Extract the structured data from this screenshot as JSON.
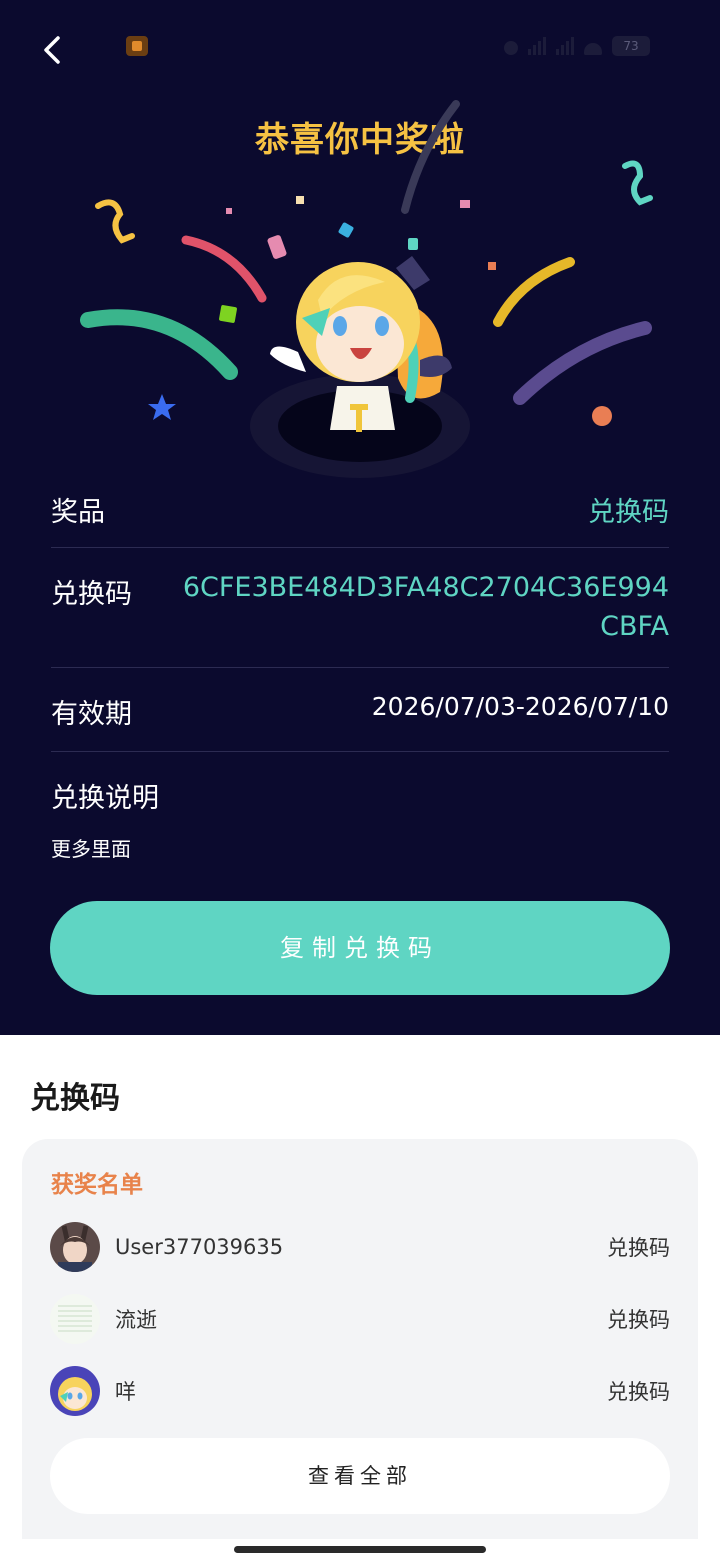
{
  "status_bar": {
    "battery": "73"
  },
  "header": {
    "title": "恭喜你中奖啦"
  },
  "details": {
    "prize_label": "奖品",
    "prize_value": "兑换码",
    "code_label": "兑换码",
    "code_value": "6CFE3BE484D3FA48C2704C36E994CBFA",
    "valid_label": "有效期",
    "valid_value": "2026/07/03-2026/07/10",
    "desc_label": "兑换说明",
    "desc_text": "更多里面"
  },
  "copy_button": {
    "label": "复制兑换码"
  },
  "bottom": {
    "section_title": "兑换码",
    "card_title": "获奖名单",
    "winners": [
      {
        "name": "User377039635",
        "prize": "兑换码"
      },
      {
        "name": "流逝",
        "prize": "兑换码"
      },
      {
        "name": "咩",
        "prize": "兑换码"
      }
    ],
    "view_all": "查看全部"
  },
  "colors": {
    "background": "#0b0a2e",
    "accent": "#5fd5c3",
    "title": "#f6c243",
    "card_title": "#e8834b"
  }
}
